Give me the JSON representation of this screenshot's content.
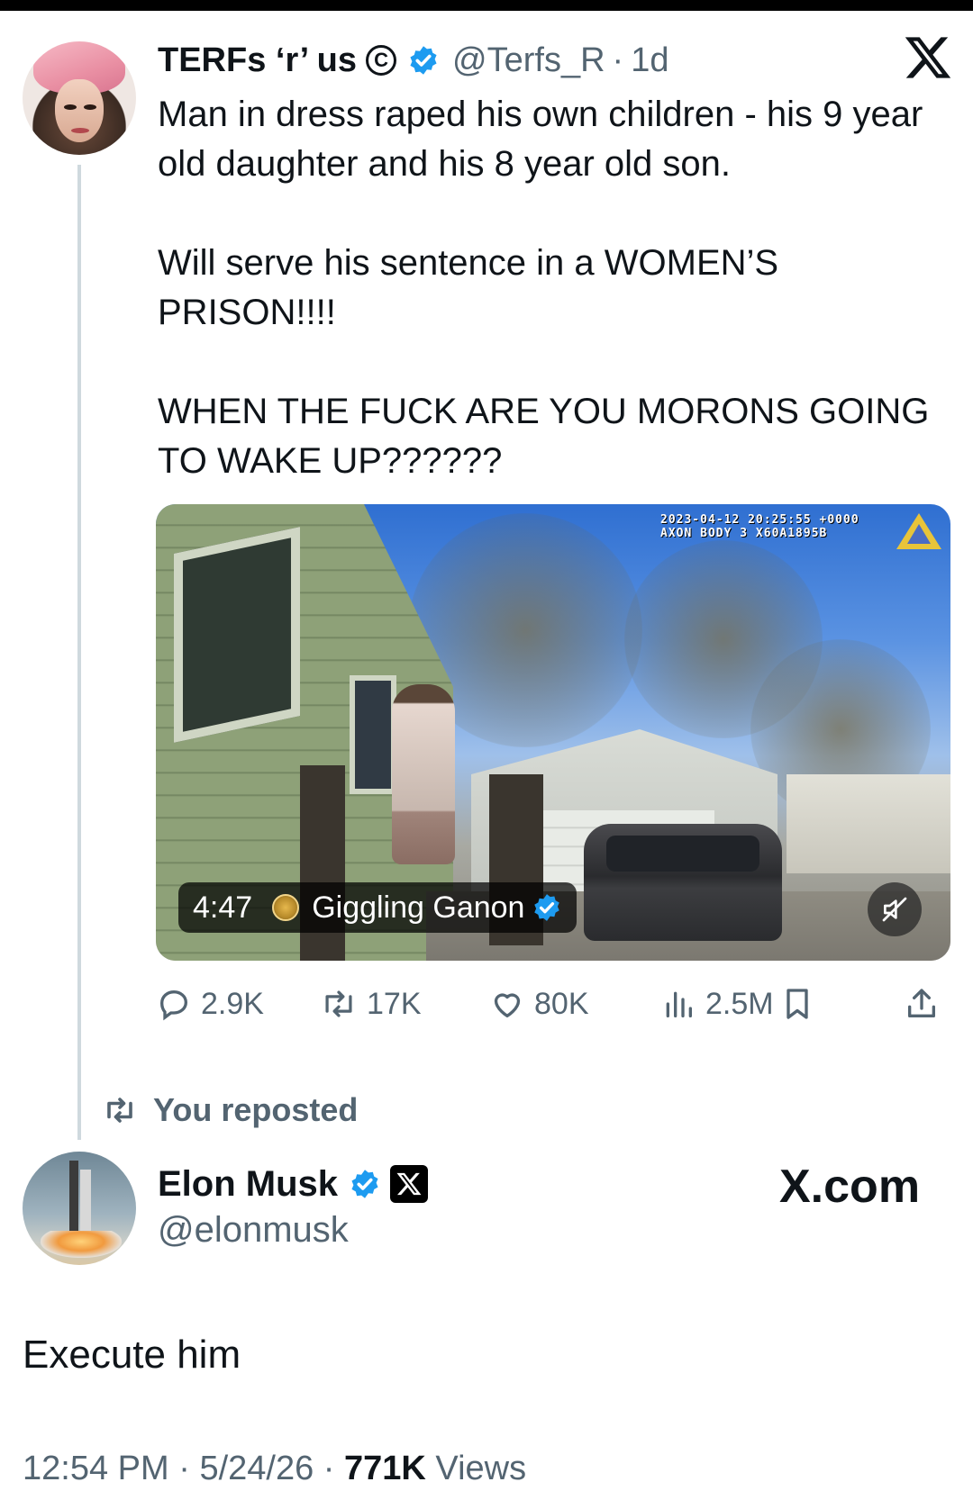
{
  "original_tweet": {
    "display_name": "TERFs ‘r’ us",
    "circle_badge": "C",
    "handle": "@Terfs_R",
    "separator": "·",
    "age": "1d",
    "icons": {
      "avatar": "profile-photo",
      "verified": "verified-check-icon",
      "platform": "x-logo-icon"
    },
    "paragraphs": [
      "Man in dress raped his own children - his 9 year old daughter and his 8 year old son.",
      "Will serve his sentence in a WOMEN’S PRISON!!!!",
      "WHEN THE FUCK ARE YOU MORONS GOING TO WAKE UP??????"
    ],
    "media": {
      "timestamp_line1": "2023-04-12 20:25:55 +0000",
      "timestamp_line2": "AXON BODY 3 X60A1895B",
      "duration": "4:47",
      "source_name": "Giggling Ganon",
      "mute_icon": "muted-speaker-icon"
    },
    "stats": {
      "replies": "2.9K",
      "reposts": "17K",
      "likes": "80K",
      "views": "2.5M"
    }
  },
  "repost_banner": {
    "label": "You reposted"
  },
  "quote_tweet": {
    "display_name": "Elon Musk",
    "handle": "@elonmusk",
    "brand_text": "X.com",
    "text": "Execute him",
    "time": "12:54 PM",
    "date": "5/24/26",
    "views_count": "771K",
    "views_label": "Views",
    "separator": "·"
  },
  "colors": {
    "verified_blue": "#1d9bf0",
    "muted_text": "#536471",
    "primary_text": "#0f1419",
    "thread_line": "#cfd9de"
  }
}
